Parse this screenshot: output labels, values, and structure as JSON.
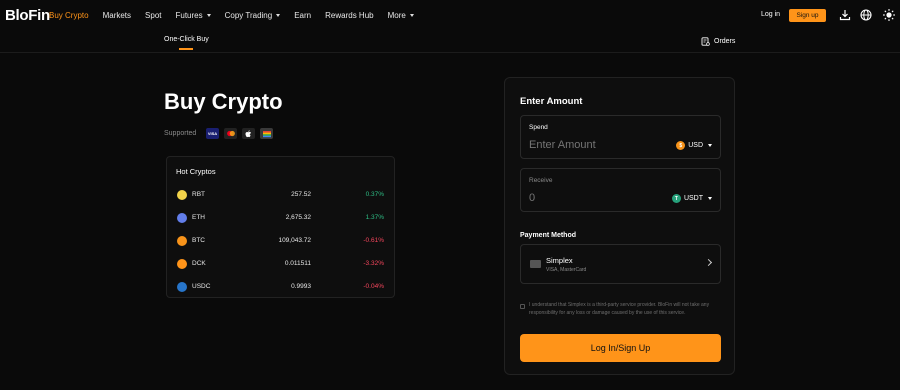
{
  "brand": "BloFin",
  "nav": {
    "items": [
      {
        "label": "Buy Crypto",
        "active": true,
        "caret": false
      },
      {
        "label": "Markets",
        "active": false,
        "caret": false
      },
      {
        "label": "Spot",
        "active": false,
        "caret": false
      },
      {
        "label": "Futures",
        "active": false,
        "caret": true
      },
      {
        "label": "Copy Trading",
        "active": false,
        "caret": true
      },
      {
        "label": "Earn",
        "active": false,
        "caret": false
      },
      {
        "label": "Rewards Hub",
        "active": false,
        "caret": false
      },
      {
        "label": "More",
        "active": false,
        "caret": true
      }
    ],
    "login": "Log in",
    "signup": "Sign up"
  },
  "subnav": {
    "tab": "One-Click Buy",
    "orders": "Orders"
  },
  "hero": {
    "title": "Buy Crypto",
    "supported": "Supported"
  },
  "hot": {
    "title": "Hot Cryptos",
    "rows": [
      {
        "symbol": "RBT",
        "price": "257.52",
        "change": "0.37%",
        "dir": "up",
        "color": "#f2d34a"
      },
      {
        "symbol": "ETH",
        "price": "2,675.32",
        "change": "1.37%",
        "dir": "up",
        "color": "#627eea"
      },
      {
        "symbol": "BTC",
        "price": "109,043.72",
        "change": "-0.61%",
        "dir": "down",
        "color": "#f7931a"
      },
      {
        "symbol": "DCK",
        "price": "0.011511",
        "change": "-3.32%",
        "dir": "down",
        "color": "#ff9419"
      },
      {
        "symbol": "USDC",
        "price": "0.9993",
        "change": "-0.04%",
        "dir": "down",
        "color": "#2775ca"
      }
    ]
  },
  "panel": {
    "title": "Enter Amount",
    "spend": {
      "label": "Spend",
      "placeholder": "Enter Amount",
      "currency": "USD"
    },
    "receive": {
      "label": "Receive",
      "placeholder": "0",
      "currency": "USDT"
    },
    "payment": {
      "title": "Payment Method",
      "name": "Simplex",
      "sub": "VISA, MasterCard"
    },
    "disclaimer": "I understand that Simplex is a third-party service provider. BloFin will not take any responsibility for any loss or damage caused by the use of this service.",
    "cta": "Log In/Sign Up"
  },
  "colors": {
    "accent": "#ff9419",
    "up": "#2ebd85",
    "down": "#f6465d"
  }
}
